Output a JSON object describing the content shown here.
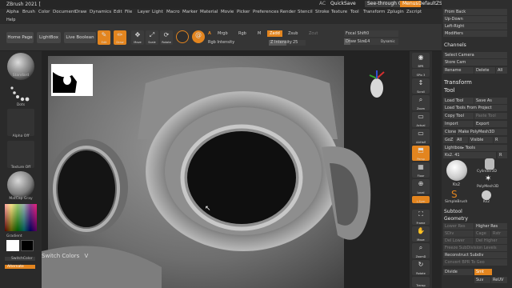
{
  "titlebar": {
    "app_title": "ZBrush 2021 [",
    "ac": "AC",
    "quicksave": "QuickSave",
    "see_through": "See-through",
    "see_through_value": "0",
    "menus": "Menus",
    "script": "DefaultZScript"
  },
  "menu": [
    "Alpha",
    "Brush",
    "Color",
    "Document",
    "Draw",
    "Dynamics",
    "Edit",
    "File",
    "Layer",
    "Light",
    "Macro",
    "Marker",
    "Material",
    "Movie",
    "Picker",
    "Preferences",
    "Render",
    "Stencil",
    "Stroke",
    "Texture",
    "Tool",
    "Transform",
    "Zplugin",
    "Zscript"
  ],
  "help": "Help",
  "toolbar": {
    "home_page": "Home Page",
    "lightbox": "LightBox",
    "live_boolean": "Live Boolean",
    "edit": "Edit",
    "draw": "Draw",
    "move": "Move",
    "scale": "Scale",
    "rotate": "Rotate",
    "a_label": "A",
    "rgb_intensity": "Rgb Intensity",
    "mrgb": "Mrgb",
    "rgb": "Rgb",
    "m": "M",
    "zadd": "Zadd",
    "zsub": "Zsub",
    "zcut": "Zcut",
    "focal_shift_label": "Focal Shift",
    "focal_shift_value": "0",
    "z_intensity_label": "Z Intensity",
    "z_intensity_value": "25",
    "draw_size_label": "Draw Size",
    "draw_size_value": "14",
    "dynamic": "Dynamic"
  },
  "left": {
    "standard": "Standard",
    "dots": "Dots",
    "alpha_off": "Alpha Off",
    "texture_off": "Texture Off",
    "matcap": "MatCap Gray",
    "gradient": "Gradient",
    "switch_color": "SwitchColor",
    "alternate": "Alternate"
  },
  "viewport": {
    "switch_colors": "Switch Colors",
    "switch_key": "V"
  },
  "shelf": [
    "BPR",
    "SPix 3",
    "Scroll",
    "Zoom",
    "Actual",
    "AAHalf",
    "Persp",
    "Floor",
    "Local",
    "Frame",
    "Move",
    "ZoomD",
    "Rotate",
    "Transp"
  ],
  "shelf_left": [
    "L.Sym"
  ],
  "right": {
    "from_back": "From Back",
    "up_down": "Up-Down",
    "left_right": "Left-Right",
    "modifiers": "Modifiers",
    "channels": "Channels",
    "select_camera": "Select Camera",
    "store_cam": "Store Cam",
    "rename": "Rename",
    "delete": "Delete",
    "all": "All",
    "transform": "Transform",
    "tool": "Tool",
    "load_tool": "Load Tool",
    "save_as": "Save As",
    "load_tools_from_project": "Load Tools From Project",
    "copy_tool": "Copy Tool",
    "paste_tool": "Paste Tool",
    "import": "Import",
    "export": "Export",
    "clone": "Clone",
    "make_polymesh": "Make PolyMesh3D",
    "goz": "GoZ",
    "all2": "All",
    "visible": "Visible",
    "r": "R",
    "lightbox_tools": "Lightbox▸ Tools",
    "ks": "Ks2.",
    "ks_value": "41",
    "rlabel": "R",
    "t_ks": "Ks2",
    "t_cyl": "Cylinder3D",
    "t_poly": "PolyMesh3D",
    "t_simple": "SimpleBrush",
    "t_ks2": "Ks2",
    "subtool": "Subtool",
    "geometry": "Geometry",
    "lower_res": "Lower Res",
    "higher_res": "Higher Res",
    "sdiv": "SDiv",
    "cage": "Cage",
    "rstr": "Rstr",
    "del_lower": "Del Lower",
    "del_higher": "Del Higher",
    "freeze": "Freeze SubDivision Levels",
    "reconstruct": "Reconstruct Subdiv",
    "convert_bpr": "Convert BPR To Geo",
    "divide": "Divide",
    "smt": "Smt",
    "suv": "Suv",
    "reuv": "ReUV"
  },
  "colors": {
    "accent": "#e3851f",
    "bg": "#1e1e1e",
    "panel": "#2e2e2e"
  }
}
